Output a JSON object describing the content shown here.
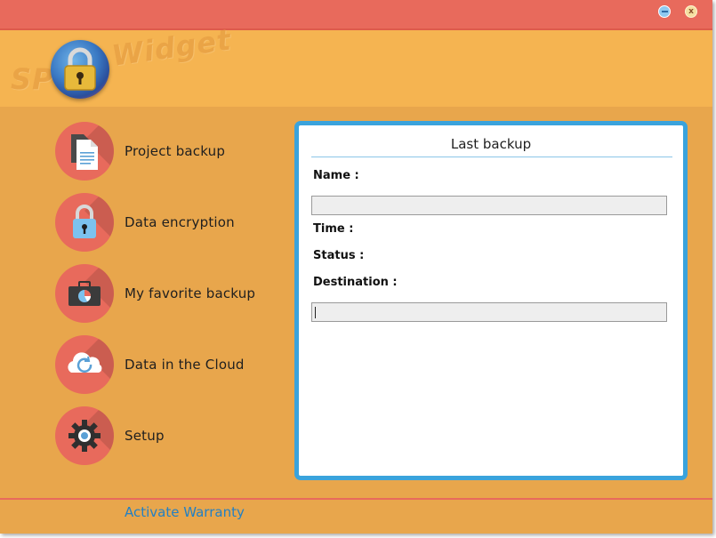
{
  "window": {
    "minimize_label": "",
    "close_label": "x"
  },
  "header": {
    "logo_sp": "SP",
    "logo_widget": "Widget"
  },
  "sidebar": {
    "items": [
      {
        "label": "Project backup",
        "icon": "document-copy-icon"
      },
      {
        "label": "Data encryption",
        "icon": "padlock-icon"
      },
      {
        "label": "My favorite backup",
        "icon": "briefcase-chart-icon"
      },
      {
        "label": "Data in the Cloud",
        "icon": "cloud-sync-icon"
      },
      {
        "label": "Setup",
        "icon": "gear-icon"
      }
    ]
  },
  "panel": {
    "title": "Last backup",
    "name_label": "Name :",
    "name_value": "",
    "time_label": "Time :",
    "status_label": "Status :",
    "destination_label": "Destination :",
    "destination_value": ""
  },
  "footer": {
    "activate_label": "Activate Warranty"
  },
  "colors": {
    "titlebar": "#e86a5c",
    "header": "#f5b451",
    "body": "#e8a64c",
    "nav_circle": "#e86a5c",
    "panel_border": "#3aa3dc",
    "link": "#2380c3"
  }
}
